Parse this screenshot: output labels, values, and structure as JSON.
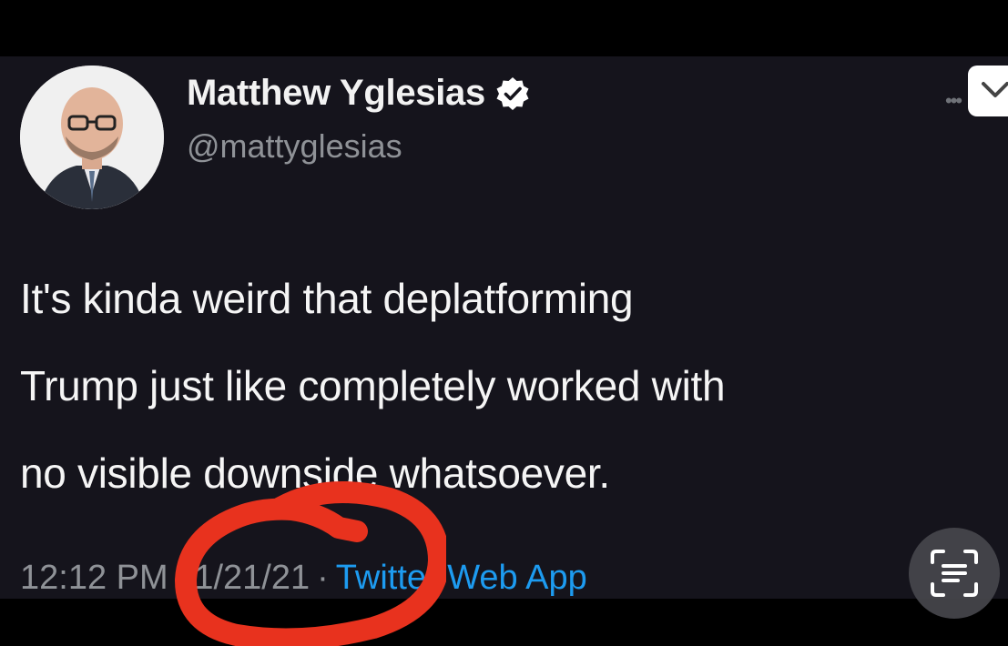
{
  "tweet": {
    "author": {
      "display_name": "Matthew Yglesias",
      "handle": "@mattyglesias",
      "verified": true
    },
    "text_lines": [
      "It's kinda weird that deplatforming",
      "Trump just like completely worked with",
      "no visible downside whatsoever."
    ],
    "time": "12:12 PM",
    "date": "1/21/21",
    "separator": "·",
    "source": "Twitter Web App"
  },
  "controls": {
    "more_icon": "more-dots-icon",
    "caret_icon": "chevron-down-icon",
    "scan_icon": "text-scan-icon"
  },
  "colors": {
    "background": "#000000",
    "card": "#15141c",
    "text": "#f5f5f5",
    "muted": "#8f9297",
    "link": "#1d9bf0",
    "verified_badge": "#ffffff",
    "annotation": "#e8321e"
  }
}
